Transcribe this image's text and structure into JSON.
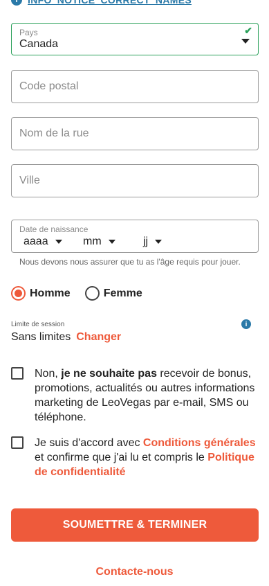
{
  "notice": {
    "text": "INFO_NOTICE_CORRECT_NAMES",
    "icon": "info-icon"
  },
  "country": {
    "label": "Pays",
    "value": "Canada",
    "icon_valid": "check-icon",
    "icon_dropdown": "caret-down-icon"
  },
  "postal_code": {
    "placeholder": "Code postal",
    "value": ""
  },
  "street": {
    "placeholder": "Nom de la rue",
    "value": ""
  },
  "city": {
    "placeholder": "Ville",
    "value": ""
  },
  "dob": {
    "label": "Date de naissance",
    "year": "aaaa",
    "month": "mm",
    "day": "jj",
    "hint": "Nous devons nous assurer que tu as l'âge requis pour jouer."
  },
  "gender": {
    "options": [
      {
        "label": "Homme",
        "selected": true
      },
      {
        "label": "Femme",
        "selected": false
      }
    ]
  },
  "session": {
    "label": "Limite de session",
    "value": "Sans limites",
    "change_label": "Changer",
    "icon": "info-icon"
  },
  "marketing": {
    "prefix": "Non, ",
    "bold": "je ne souhaite pas",
    "suffix": " recevoir de bonus, promotions, actualités ou autres informations marketing de LeoVegas par e-mail, SMS ou téléphone.",
    "checked": false
  },
  "terms": {
    "prefix": "Je suis d'accord avec ",
    "terms_link": "Conditions générales",
    "middle": " et confirme que j'ai lu et compris le ",
    "privacy_link": "Politique de confidentialité",
    "checked": false
  },
  "submit_label": "SOUMETTRE & TERMINER",
  "contact_label": "Contacte-nous",
  "colors": {
    "accent": "#ee5a3b",
    "info": "#2a79a8",
    "valid": "#2aa05a"
  }
}
